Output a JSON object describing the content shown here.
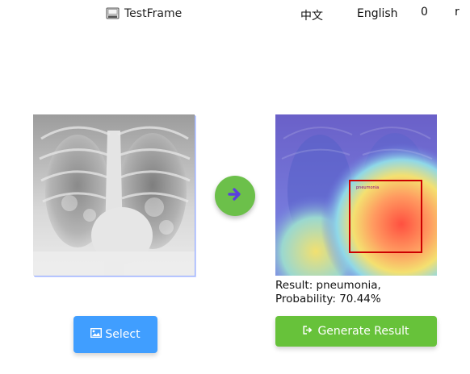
{
  "window": {
    "title": "TestFrame",
    "app_icon": "disk-icon",
    "lang_cn_label": "中文",
    "lang_en_label": "English",
    "minimize_label": "0",
    "close_label": "r"
  },
  "main": {
    "input_image": "chest-xray",
    "arrow_icon": "arrow-right-icon",
    "output_image": "xray-heatmap-overlay",
    "detection_box_label": "pneumonia",
    "result_line1": "Result: pneumonia,",
    "result_line2": "Probability: 70.44%",
    "select_icon": "image-icon",
    "select_label": "Select",
    "generate_icon": "sign-out-icon",
    "generate_label": "Generate Result"
  },
  "colors": {
    "primary": "#409eff",
    "success": "#67c23a",
    "arrow_green": "#6cc04a",
    "arrow_blue": "#5b3fe0",
    "box_red": "#cc0000"
  }
}
